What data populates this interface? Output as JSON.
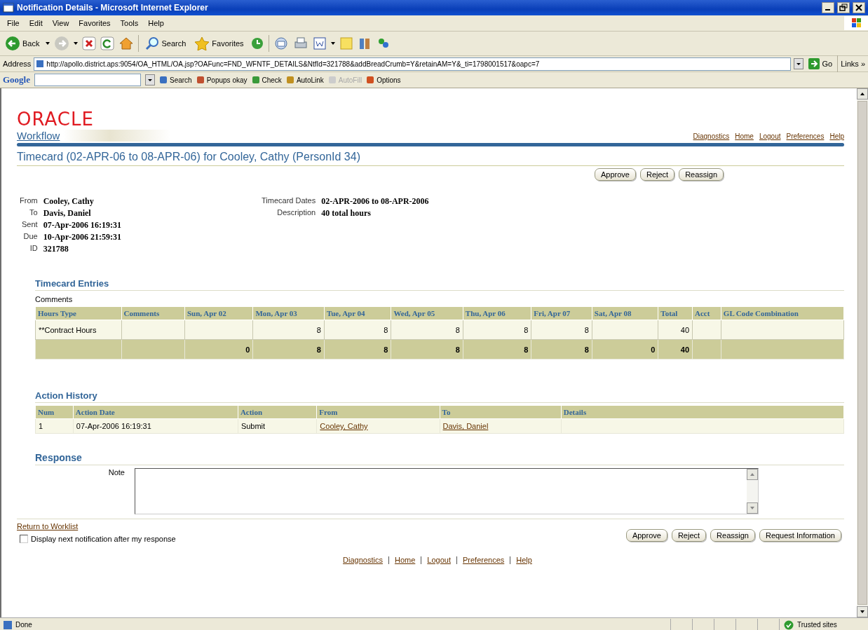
{
  "window": {
    "title": "Notification Details - Microsoft Internet Explorer"
  },
  "menu": [
    "File",
    "Edit",
    "View",
    "Favorites",
    "Tools",
    "Help"
  ],
  "toolbar": {
    "back": "Back",
    "search": "Search",
    "favorites": "Favorites"
  },
  "address": {
    "label": "Address",
    "url": "http://apollo.district.aps:9054/OA_HTML/OA.jsp?OAFunc=FND_WFNTF_DETAILS&NtfId=321788&addBreadCrumb=Y&retainAM=Y&_ti=1798001517&oapc=7",
    "go": "Go",
    "links": "Links »"
  },
  "google_bar": {
    "logo": "Google",
    "items": [
      {
        "label": "Search",
        "disabled": false
      },
      {
        "label": "Popups okay",
        "disabled": false
      },
      {
        "label": "Check",
        "disabled": false
      },
      {
        "label": "AutoLink",
        "disabled": false
      },
      {
        "label": "AutoFill",
        "disabled": true
      },
      {
        "label": "Options",
        "disabled": false
      }
    ]
  },
  "brand": {
    "logo": "ORACLE",
    "product": "Workflow"
  },
  "global_links": [
    "Diagnostics",
    "Home",
    "Logout",
    "Preferences",
    "Help"
  ],
  "heading": "Timecard (02-APR-06 to 08-APR-06) for Cooley, Cathy (PersonId 34)",
  "top_buttons": [
    "Approve",
    "Reject",
    "Reassign"
  ],
  "header_left": [
    {
      "label": "From",
      "value": "Cooley, Cathy"
    },
    {
      "label": "To",
      "value": "Davis, Daniel"
    },
    {
      "label": "Sent",
      "value": "07-Apr-2006 16:19:31"
    },
    {
      "label": "Due",
      "value": "10-Apr-2006 21:59:31"
    },
    {
      "label": "ID",
      "value": "321788"
    }
  ],
  "header_right": [
    {
      "label": "Timecard Dates",
      "value": "02-APR-2006 to 08-APR-2006"
    },
    {
      "label": "Description",
      "value": "40 total hours"
    }
  ],
  "timecard": {
    "title": "Timecard Entries",
    "comments_label": "Comments",
    "columns": [
      "Hours Type",
      "Comments",
      "Sun, Apr 02",
      "Mon, Apr 03",
      "Tue, Apr 04",
      "Wed, Apr 05",
      "Thu, Apr 06",
      "Fri, Apr 07",
      "Sat, Apr 08",
      "Total",
      "Acct",
      "GL Code Combination"
    ],
    "rows": [
      [
        {
          "kind": "text",
          "text": "**Contract Hours"
        },
        {
          "kind": "empty"
        },
        {
          "kind": "empty"
        },
        {
          "kind": "number",
          "text": "8"
        },
        {
          "kind": "number",
          "text": "8"
        },
        {
          "kind": "number",
          "text": "8"
        },
        {
          "kind": "number",
          "text": "8"
        },
        {
          "kind": "number",
          "text": "8"
        },
        {
          "kind": "empty"
        },
        {
          "kind": "number",
          "text": "40"
        },
        {
          "kind": "empty"
        },
        {
          "kind": "empty"
        }
      ]
    ],
    "totals": [
      {
        "kind": "empty"
      },
      {
        "kind": "empty"
      },
      {
        "kind": "number",
        "text": "0"
      },
      {
        "kind": "number",
        "text": "8"
      },
      {
        "kind": "number",
        "text": "8"
      },
      {
        "kind": "number",
        "text": "8"
      },
      {
        "kind": "number",
        "text": "8"
      },
      {
        "kind": "number",
        "text": "8"
      },
      {
        "kind": "number",
        "text": "0"
      },
      {
        "kind": "number",
        "text": "40"
      },
      {
        "kind": "empty"
      },
      {
        "kind": "empty"
      }
    ]
  },
  "action_history": {
    "title": "Action History",
    "columns": [
      "Num",
      "Action Date",
      "Action",
      "From",
      "To",
      "Details"
    ],
    "rows": [
      [
        {
          "kind": "text",
          "text": "1"
        },
        {
          "kind": "text",
          "text": "07-Apr-2006 16:19:31"
        },
        {
          "kind": "text",
          "text": "Submit"
        },
        {
          "kind": "link",
          "text": "Cooley, Cathy"
        },
        {
          "kind": "link",
          "text": "Davis, Daniel"
        },
        {
          "kind": "empty"
        }
      ]
    ]
  },
  "response": {
    "title": "Response",
    "note_label": "Note"
  },
  "return_link": "Return to Worklist",
  "next_checkbox": {
    "label": "Display next notification after my response",
    "checked": false
  },
  "bottom_buttons": [
    "Approve",
    "Reject",
    "Reassign",
    "Request Information"
  ],
  "footer_links": [
    "Diagnostics",
    "Home",
    "Logout",
    "Preferences",
    "Help"
  ],
  "status_bar": {
    "text": "Done",
    "zone": "Trusted sites"
  }
}
